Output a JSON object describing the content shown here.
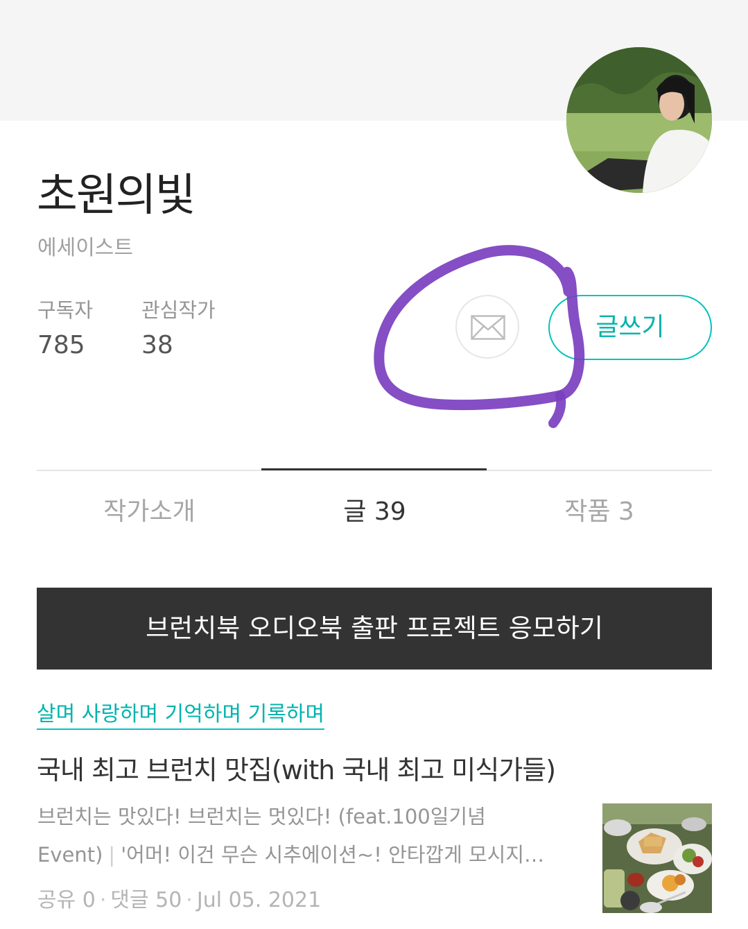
{
  "profile": {
    "name": "초원의빛",
    "job": "에세이스트",
    "stats": [
      {
        "label": "구독자",
        "value": "785"
      },
      {
        "label": "관심작가",
        "value": "38"
      }
    ],
    "write_label": "글쓰기",
    "mail_icon": "envelope-icon"
  },
  "tabs": [
    {
      "label": "작가소개",
      "active": false
    },
    {
      "label": "글 39",
      "active": true
    },
    {
      "label": "작품 3",
      "active": false
    }
  ],
  "banner": {
    "label": "브런치북 오디오북 출판 프로젝트 응모하기"
  },
  "post": {
    "magazine": "살며 사랑하며 기억하며 기록하며",
    "title": "국내 최고 브런치 맛집(with 국내 최고 미식가들)",
    "subtitle": "브런치는 맛있다! 브런치는 멋있다! (feat.100일기념 Event)",
    "subtitle_line1": "브런치는 맛있다! 브런치는 멋있다! (feat.100일기념",
    "subtitle_line2": "Event)",
    "separator": "|",
    "excerpt": "'어머! 이건 무슨 시추에이션~! 안타깝게 모시지…",
    "shares": "공유 0",
    "comments": "댓글 50",
    "date": "Jul 05. 2021"
  },
  "colors": {
    "accent": "#00c3bd",
    "banner_bg": "#333333",
    "annotation": "#7b3fbf"
  }
}
